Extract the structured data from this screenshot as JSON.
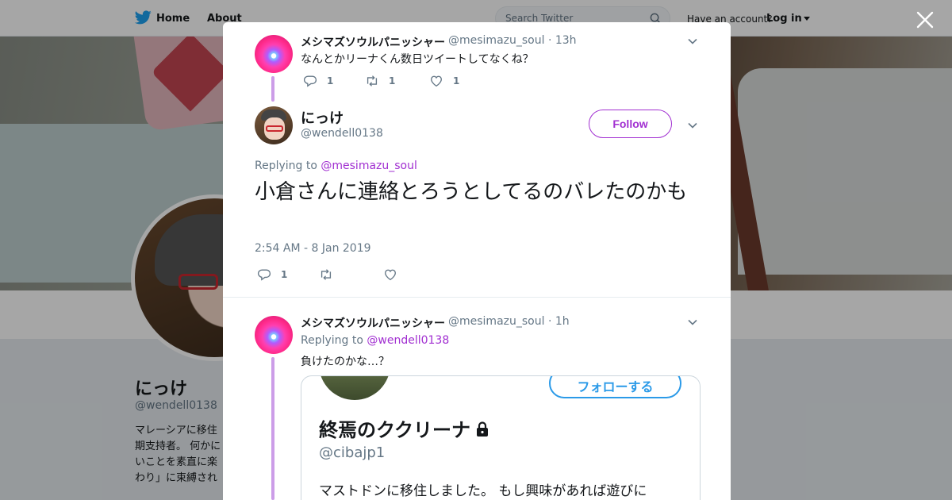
{
  "topbar": {
    "home_label": "Home",
    "about_label": "About",
    "search_placeholder": "Search Twitter",
    "have_account": "Have an account?",
    "login_label": "Log in"
  },
  "profile": {
    "name": "にっけ",
    "handle": "@wendell0138",
    "bio": "マレーシアに移住 期支持者。 何かに いことを素直に楽 わり」に束縛され"
  },
  "thread": {
    "parent": {
      "name": "メシマズソウルパニッシャー",
      "handle": "@mesimazu_soul",
      "time": "· 13h",
      "text": "なんとかリーナくん数日ツイートしてなくね？",
      "replies": "1",
      "retweets": "1",
      "likes": "1"
    },
    "main": {
      "name": "にっけ",
      "handle": "@wendell0138",
      "follow_label": "Follow",
      "replying_prefix": "Replying to",
      "replying_to": "@mesimazu_soul",
      "text": "小倉さんに連絡とろうとしてるのバレたのかも",
      "timestamp": "2:54 AM - 8 Jan 2019",
      "replies": "1"
    },
    "reply": {
      "name": "メシマズソウルパニッシャー",
      "handle": "@mesimazu_soul",
      "time": "· 1h",
      "replying_prefix": "Replying to",
      "replying_to": "@wendell0138",
      "text": "負けたのかな…？",
      "embed": {
        "follow_label": "フォローする",
        "name": "終焉のククリーナ",
        "handle": "@cibajp1",
        "bio": "マストドンに移住しました。 もし興味があれば遊びに"
      }
    }
  },
  "colors": {
    "accent": "#a12fd1",
    "twitter_blue": "#1da1f2",
    "thread_line": "#cc9de8",
    "secondary_text": "#657786"
  }
}
